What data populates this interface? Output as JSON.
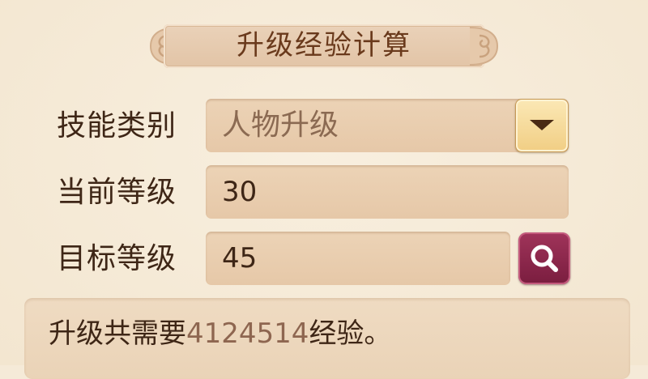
{
  "title": "升级经验计算",
  "form": {
    "skill_type_label": "技能类别",
    "skill_type_value": "人物升级",
    "current_level_label": "当前等级",
    "current_level_value": "30",
    "target_level_label": "目标等级",
    "target_level_value": "45"
  },
  "result": {
    "prefix": "升级共需要",
    "exp_value": "4124514",
    "suffix": "经验。"
  },
  "icons": {
    "dropdown": "chevron-down-icon",
    "search": "search-icon"
  },
  "colors": {
    "search_button": "#8a2548",
    "dropdown_button": "#f5d893",
    "field_bg": "#e9ceb0",
    "text": "#3e2616"
  }
}
